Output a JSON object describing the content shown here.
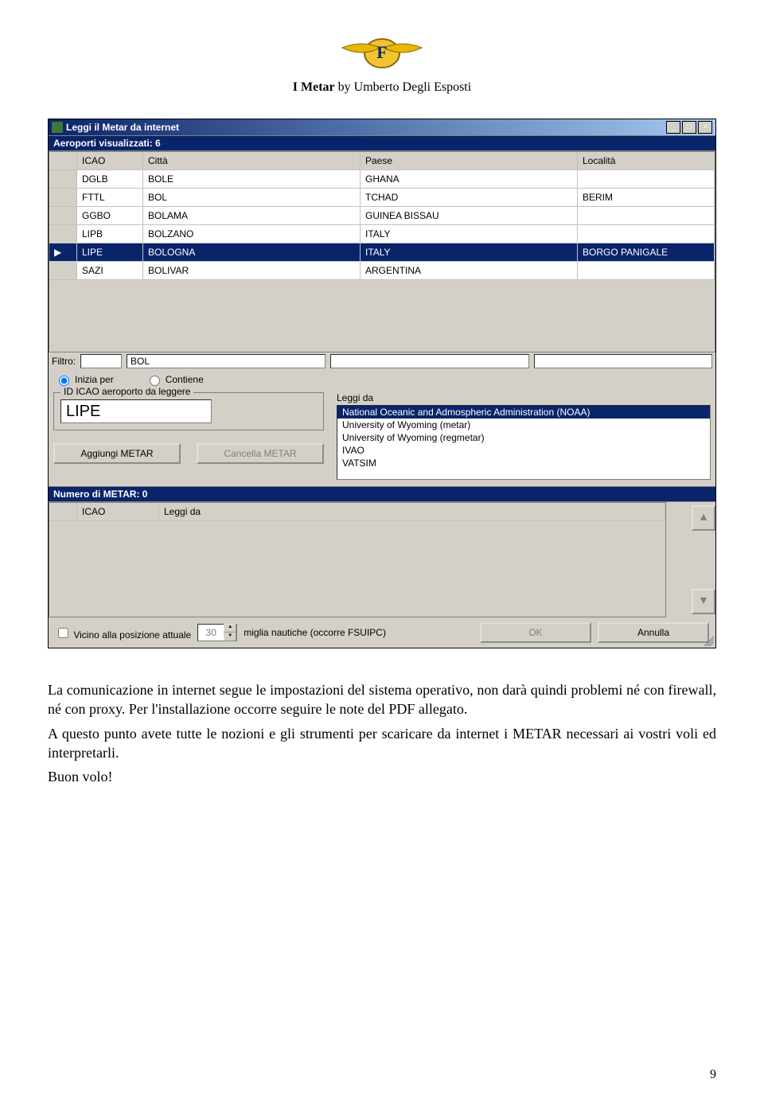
{
  "doc": {
    "title_bold": "I Metar",
    "title_rest": " by Umberto Degli Esposti",
    "page_number": "9"
  },
  "win": {
    "title": "Leggi il Metar da internet",
    "min": "_",
    "max": "□",
    "close": "×"
  },
  "airports": {
    "header": "Aeroporti visualizzati: 6",
    "cols": {
      "icao": "ICAO",
      "city": "Città",
      "paese": "Paese",
      "localita": "Località"
    },
    "rows": [
      {
        "icao": "DGLB",
        "city": "BOLE",
        "paese": "GHANA",
        "loc": "",
        "selected": false
      },
      {
        "icao": "FTTL",
        "city": "BOL",
        "paese": "TCHAD",
        "loc": "BERIM",
        "selected": false
      },
      {
        "icao": "GGBO",
        "city": "BOLAMA",
        "paese": "GUINEA BISSAU",
        "loc": "",
        "selected": false
      },
      {
        "icao": "LIPB",
        "city": "BOLZANO",
        "paese": "ITALY",
        "loc": "",
        "selected": false
      },
      {
        "icao": "LIPE",
        "city": "BOLOGNA",
        "paese": "ITALY",
        "loc": "BORGO PANIGALE",
        "selected": true
      },
      {
        "icao": "SAZI",
        "city": "BOLIVAR",
        "paese": "ARGENTINA",
        "loc": "",
        "selected": false
      }
    ]
  },
  "filter": {
    "label": "Filtro:",
    "f1": "",
    "f2": "BOL",
    "f3": "",
    "f4": "",
    "inizia": "Inizia per",
    "contiene": "Contiene"
  },
  "id_section": {
    "legend": "ID ICAO aeroporto da leggere",
    "value": "LIPE",
    "add": "Aggiungi METAR",
    "del": "Cancella METAR"
  },
  "leggi": {
    "label": "Leggi da",
    "items": [
      "National Oceanic and Admospheric Administration (NOAA)",
      "University of Wyoming (metar)",
      "University of Wyoming (regmetar)",
      "IVAO",
      "VATSIM"
    ],
    "selected_index": 0
  },
  "metar2": {
    "header": "Numero di METAR: 0",
    "col_icao": "ICAO",
    "col_leggi": "Leggi da"
  },
  "bottom": {
    "check": "Vicino alla posizione attuale",
    "miles": "30",
    "miles_label": "miglia nautiche (occorre FSUIPC)",
    "ok": "OK",
    "cancel": "Annulla"
  },
  "paragraphs": {
    "p1": "La comunicazione in internet segue le impostazioni del sistema operativo, non darà quindi problemi né con firewall, né con proxy. Per l'installazione occorre seguire le note del PDF allegato.",
    "p2": "A questo punto avete tutte le nozioni e gli strumenti per scaricare da internet i METAR necessari ai vostri voli ed interpretarli.",
    "p3": "Buon volo!"
  }
}
